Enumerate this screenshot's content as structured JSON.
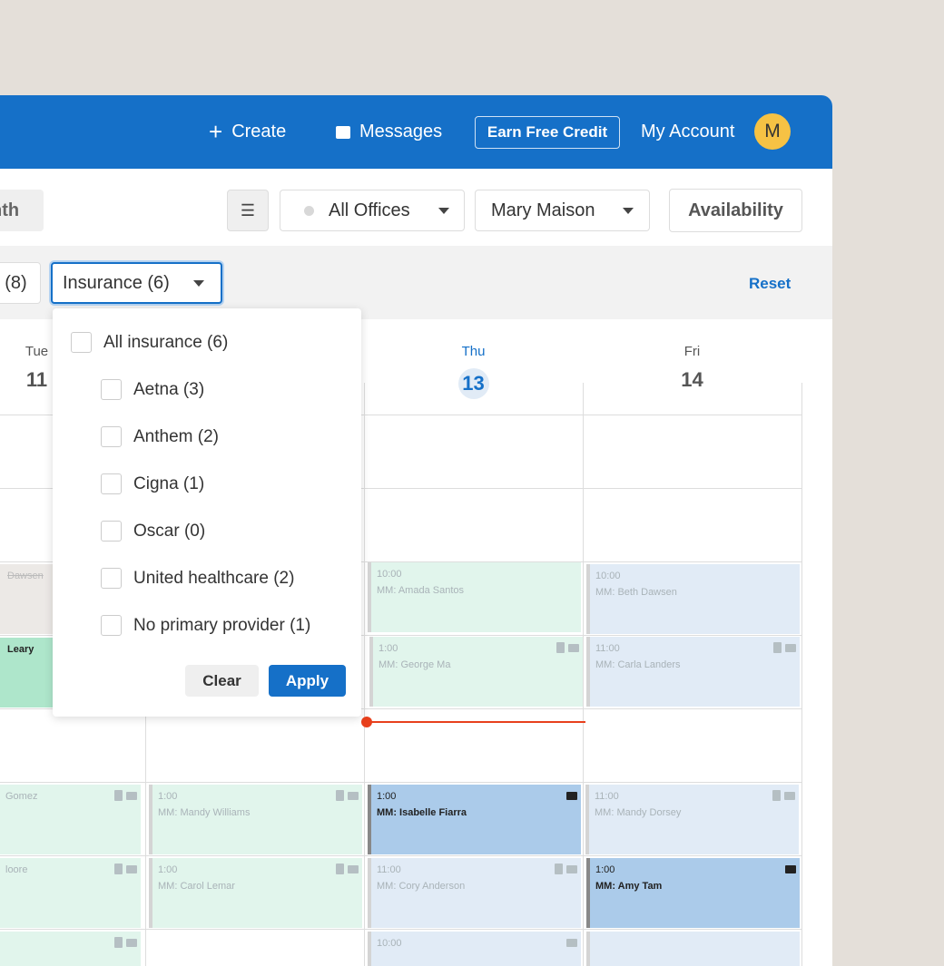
{
  "header": {
    "create": "Create",
    "messages": "Messages",
    "earn_credit": "Earn Free Credit",
    "my_account": "My Account",
    "avatar_initial": "M",
    "brand_color": "#1570c8"
  },
  "toolbar": {
    "month": "nth",
    "offices": "All Offices",
    "provider": "Mary Maison",
    "availability": "Availability"
  },
  "filters": {
    "prev_filter": "(8)",
    "insurance": "Insurance (6)",
    "reset": "Reset"
  },
  "days": [
    {
      "name": "Tue",
      "date": "11"
    },
    {
      "name": "Thu",
      "date": "13"
    },
    {
      "name": "Fri",
      "date": "14"
    }
  ],
  "dropdown": {
    "all": "All insurance (6)",
    "options": [
      "Aetna (3)",
      "Anthem (2)",
      "Cigna (1)",
      "Oscar (0)",
      "United healthcare (2)",
      "No primary provider (1)"
    ],
    "clear": "Clear",
    "apply": "Apply"
  },
  "events": [
    {
      "time": "",
      "name": "Dawsen"
    },
    {
      "time": "",
      "name": "Leary"
    },
    {
      "time": "",
      "name": "Gomez"
    },
    {
      "time": "",
      "name": "loore"
    },
    {
      "time": "1:00",
      "name": "MM: Mandy Williams"
    },
    {
      "time": "1:00",
      "name": "MM: Carol Lemar"
    },
    {
      "time": "10:00",
      "name": "MM: Amada Santos"
    },
    {
      "time": "1:00",
      "name": "MM: George Ma"
    },
    {
      "time": "1:00",
      "name": "MM: Isabelle Fiarra"
    },
    {
      "time": "11:00",
      "name": "MM: Cory Anderson"
    },
    {
      "time": "10:00",
      "name": ""
    },
    {
      "time": "10:00",
      "name": "MM: Beth Dawsen"
    },
    {
      "time": "11:00",
      "name": "MM: Carla Landers"
    },
    {
      "time": "11:00",
      "name": "MM: Mandy Dorsey"
    },
    {
      "time": "1:00",
      "name": "MM: Amy Tam"
    }
  ]
}
